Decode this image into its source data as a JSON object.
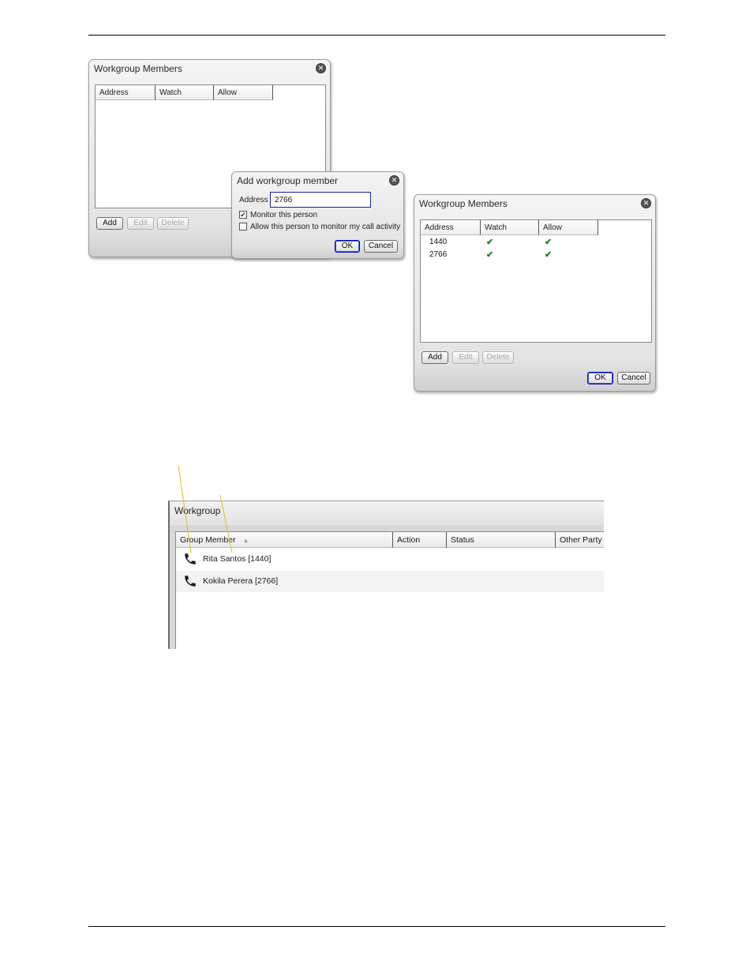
{
  "dialog_a": {
    "title": "Workgroup Members",
    "columns": [
      "Address",
      "Watch",
      "Allow"
    ],
    "buttons": {
      "add": "Add",
      "edit": "Edit",
      "delete": "Delete"
    }
  },
  "dialog_add": {
    "title": "Add workgroup member",
    "address_label": "Address",
    "address_value": "2766",
    "monitor_label": "Monitor this person",
    "monitor_checked": true,
    "allow_label": "Allow this person to monitor my call activity",
    "allow_checked": false,
    "ok_label": "OK",
    "cancel_label": "Cancel"
  },
  "dialog_b": {
    "title": "Workgroup Members",
    "columns": [
      "Address",
      "Watch",
      "Allow"
    ],
    "rows": [
      {
        "address": "1440",
        "watch": true,
        "allow": true
      },
      {
        "address": "2766",
        "watch": true,
        "allow": true
      }
    ],
    "check_glyph": "✔",
    "buttons": {
      "add": "Add",
      "edit": "Edit",
      "delete": "Delete",
      "ok": "OK",
      "cancel": "Cancel"
    }
  },
  "workgroup": {
    "title": "Workgroup",
    "columns": [
      "Group Member",
      "Action",
      "Status",
      "Other Party"
    ],
    "sort_glyph": "▲",
    "members": [
      {
        "name": "Rita Santos [1440]",
        "icon": "phone-icon"
      },
      {
        "name": "Kokila Perera [2766]",
        "icon": "phone-icon"
      }
    ]
  },
  "colors": {
    "callout": "#d6c321",
    "check": "#2a7a2a",
    "focus": "#1a1aa0"
  }
}
